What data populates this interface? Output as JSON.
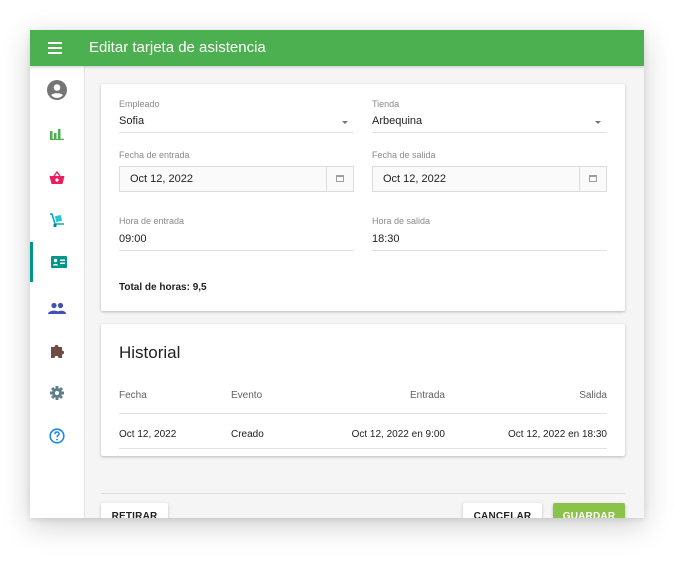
{
  "app": {
    "title": "Editar tarjeta de asistencia"
  },
  "sidebar": {
    "items": [
      {
        "icon": "account-circle-icon"
      },
      {
        "icon": "bar-chart-icon"
      },
      {
        "icon": "shopping-basket-icon"
      },
      {
        "icon": "hand-truck-icon"
      },
      {
        "icon": "id-card-icon",
        "active": true
      },
      {
        "icon": "people-icon"
      },
      {
        "icon": "puzzle-icon"
      },
      {
        "icon": "settings-icon"
      },
      {
        "icon": "help-icon"
      }
    ]
  },
  "form": {
    "empleado": {
      "label": "Empleado",
      "value": "Sofia"
    },
    "tienda": {
      "label": "Tienda",
      "value": "Arbequina"
    },
    "fecha_entrada": {
      "label": "Fecha de entrada",
      "value": "Oct 12, 2022"
    },
    "fecha_salida": {
      "label": "Fecha de salida",
      "value": "Oct 12, 2022"
    },
    "hora_entrada": {
      "label": "Hora de entrada",
      "value": "09:00"
    },
    "hora_salida": {
      "label": "Hora de salida",
      "value": "18:30"
    },
    "total": "Total de horas: 9,5"
  },
  "history": {
    "title": "Historial",
    "columns": [
      "Fecha",
      "Evento",
      "Entrada",
      "Salida"
    ],
    "rows": [
      [
        "Oct 12, 2022",
        "Creado",
        "Oct 12, 2022 en 9:00",
        "Oct 12, 2022 en 18:30"
      ]
    ]
  },
  "actions": {
    "retirar": "RETIRAR",
    "cancelar": "CANCELAR",
    "guardar": "GUARDAR"
  },
  "colors": {
    "appbar": "#4caf50",
    "primary_button": "#8bc34a",
    "active_indicator": "#009688"
  }
}
